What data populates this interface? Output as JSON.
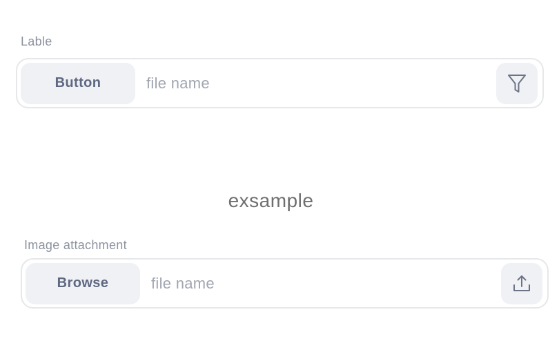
{
  "upload_filter": {
    "label": "Lable",
    "button_label": "Button",
    "file_name_placeholder": "file name",
    "icon": "filter-icon"
  },
  "caption": "exsample",
  "image_attachment": {
    "label": "Image attachment",
    "button_label": "Browse",
    "file_name_placeholder": "file name",
    "icon": "upload-icon"
  },
  "colors": {
    "label_text": "#8b929f",
    "button_bg": "#f0f1f5",
    "button_text": "#5e6880",
    "border": "#e6e7ea",
    "placeholder_text": "#a0a5b0",
    "caption_text": "#6f6f6f",
    "icon_stroke": "#6b7386"
  }
}
